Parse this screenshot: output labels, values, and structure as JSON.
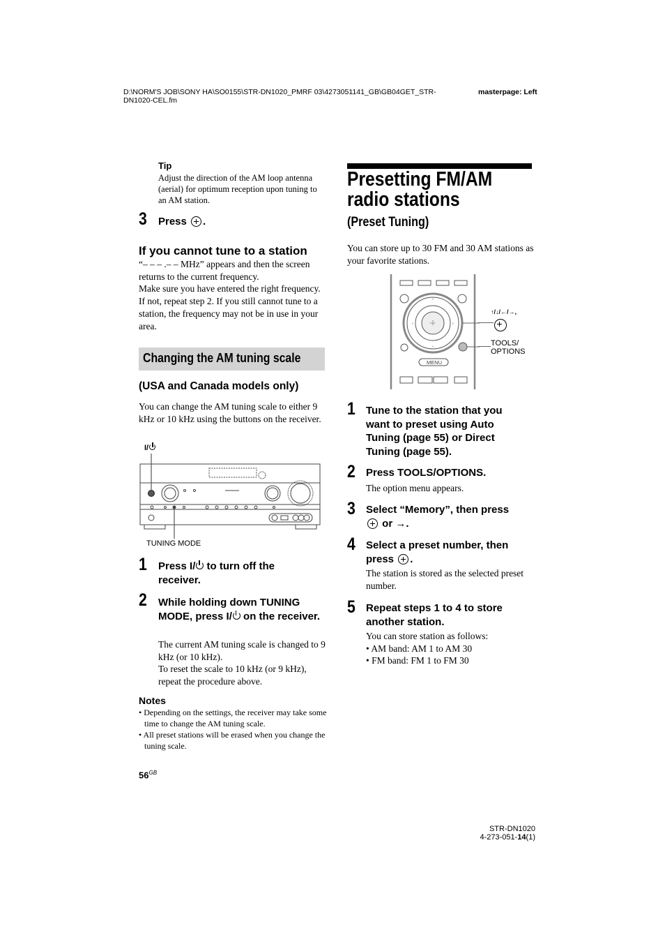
{
  "header": {
    "file_path": "D:\\NORM'S JOB\\SONY HA\\SO0155\\STR-DN1020_PMRF 03\\4273051141_GB\\GB04GET_STR-DN1020-CEL.fm",
    "masterpage": "masterpage: Left"
  },
  "left": {
    "tip": {
      "label": "Tip",
      "text": "Adjust the direction of the AM loop antenna (aerial) for optimum reception upon tuning to an AM station."
    },
    "step3": {
      "number": "3",
      "text_before": "Press",
      "text_after": "."
    },
    "cannot_tune": {
      "heading": "If you cannot tune to a station",
      "paragraph1": "“– – – .– – MHz” appears and then the screen returns to the current frequency.",
      "paragraph2": "Make sure you have entered the right frequency. If not, repeat step 2. If you still cannot tune to a station, the frequency may not be in use in your area."
    },
    "section_title": "Changing the AM tuning scale",
    "models_heading": "(USA and Canada models only)",
    "intro": "You can change the AM tuning scale to either 9 kHz or 10 kHz using the buttons on the receiver.",
    "receiver_diagram": {
      "power_label": "I/",
      "tuning_mode_label": "TUNING MODE"
    },
    "steps": [
      {
        "number": "1",
        "text_a": "Press I/",
        "text_b": " to turn off the receiver."
      },
      {
        "number": "2",
        "text_a": "While holding down TUNING MODE, press I/",
        "text_b": " on the receiver.",
        "detail1": "The current AM tuning scale is changed to 9 kHz (or 10 kHz).",
        "detail2": "To reset the scale to 10 kHz (or 9 kHz), repeat the procedure above."
      }
    ],
    "notes": {
      "label": "Notes",
      "items": [
        "• Depending on the settings, the receiver may take some time to change the AM tuning scale.",
        "• All preset stations will be erased when you change the tuning scale."
      ]
    },
    "page_number": "56",
    "page_suffix": "GB"
  },
  "right": {
    "title": "Presetting FM/AM radio stations",
    "subtitle": "(Preset Tuning)",
    "intro": "You can store up to 30 FM and 30 AM stations as your favorite stations.",
    "remote_diagram": {
      "arrows_label": "↑/↓/←/→,",
      "tools_label_line1": "TOOLS/",
      "tools_label_line2": "OPTIONS",
      "menu_button": "MENU"
    },
    "steps": [
      {
        "number": "1",
        "text": "Tune to the station that you want to preset using Auto Tuning (page 55) or Direct Tuning (page 55)."
      },
      {
        "number": "2",
        "text": "Press TOOLS/OPTIONS.",
        "detail": "The option menu appears."
      },
      {
        "number": "3",
        "text_before": "Select “Memory”, then press",
        "text_mid": " or ",
        "text_arrow": "→",
        "text_after": "."
      },
      {
        "number": "4",
        "text_before": "Select a preset number, then press",
        "text_after": ".",
        "detail": "The station is stored as the selected preset number."
      },
      {
        "number": "5",
        "text": "Repeat steps 1 to 4 to store another station.",
        "detail": "You can store station as follows:",
        "bullets": [
          "• AM band: AM 1 to AM 30",
          "• FM band: FM 1 to FM 30"
        ]
      }
    ]
  },
  "footer": {
    "model": "STR-DN1020",
    "code_prefix": "4-273-051-",
    "code_bold": "14",
    "code_suffix": "(1)"
  }
}
